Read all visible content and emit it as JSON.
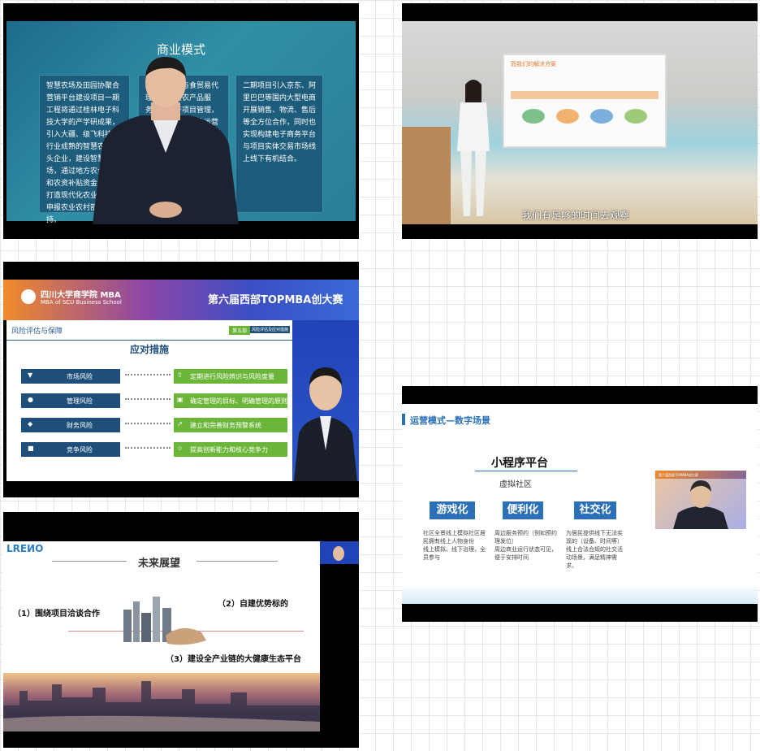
{
  "panel1": {
    "slide_title": "商业模式",
    "card1": "智慧农场及田园协聚合营销平台建设项目一期工程将通过桂林电子科技大学的产学研成果，引入大疆、级飞科技等行业成熟的智慧农业龙头企业，建设智慧农场，通过地方农合贷款和农资补贴资金支持，打造现代化农业示范，申报农业农村部项目支持。",
    "card2": "经营农产品与食贸易代理等外向型农产品服务、房地产项目管理，农产品生产、农业运营与产品深加工并确保合储",
    "card3": "二期项目引入京东、阿里巴巴等国内大型电商开展销售、物流、售后等全方位合作，同时也实现构建电子商务平台与项目实体交易市场线上线下有机结合。"
  },
  "panel2": {
    "slide_title": "而我们的解决方案",
    "caption": "我们有足够的时间去观察"
  },
  "panel3": {
    "school_name": "四川大学商学院 MBA",
    "school_en": "MBA of SCU Business School",
    "contest_title": "第六届西部TOPMBA创大赛",
    "section": "风险评估与保障",
    "section_tag": "第五部",
    "section_tag2": "风险评估及应对措施",
    "measures_title": "应对措施",
    "risks": [
      "市场风险",
      "管理风险",
      "财务风险",
      "竞争风险"
    ],
    "measures": [
      "定期进行风险辨识与风险度量",
      "确定管理的目标、明确管理的原则",
      "建立和完善财务预警系统",
      "提高创新能力和核心竞争力"
    ]
  },
  "panel4": {
    "logo": "LREИO",
    "title": "未来展望",
    "point1": "（1）围绕项目洽谈合作",
    "point2": "（2）自建优势标的",
    "point3": "（3）建设全产业链的大健康生态平台"
  },
  "panel5": {
    "section": "运营模式—数字场景",
    "platform": "小程序平台",
    "community": "虚拟社区",
    "tags": [
      "游戏化",
      "便利化",
      "社交化"
    ],
    "desc1": "社区全景线上模拟社区居民拥有线上人物身份\n线上模拟、线下治理，全员参与",
    "desc2": "周边服务预约（例如预约理发位）\n周边商业运行状态可见，便于安排时间",
    "desc3": "为居民提供线下无法实现的（设备、时间等）线上合法合规的社交活动场景，满足精神需求。",
    "cam_header": "第六届西部TOPMBA创大赛"
  }
}
